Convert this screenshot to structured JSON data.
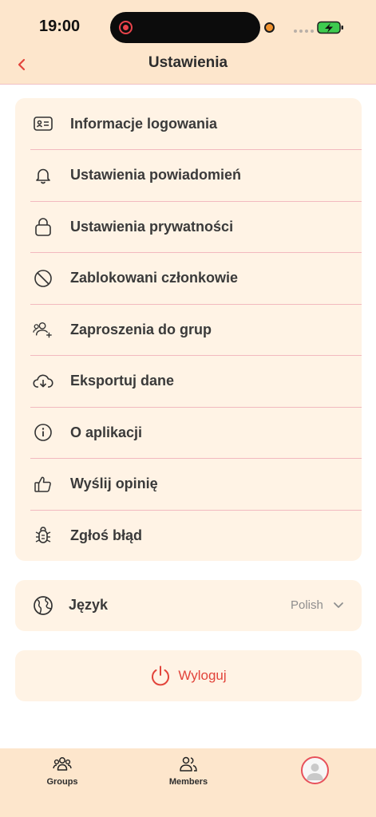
{
  "status_bar": {
    "time": "19:00"
  },
  "header": {
    "back_icon": "chevron-left-icon",
    "title": "Ustawienia"
  },
  "menu": {
    "items": [
      {
        "label": "Informacje logowania",
        "icon": "id-card-icon"
      },
      {
        "label": "Ustawienia powiadomień",
        "icon": "bell-icon"
      },
      {
        "label": "Ustawienia prywatności",
        "icon": "lock-icon"
      },
      {
        "label": "Zablokowani członkowie",
        "icon": "blocked-icon"
      },
      {
        "label": "Zaproszenia do grup",
        "icon": "user-plus-icon"
      },
      {
        "label": "Eksportuj dane",
        "icon": "cloud-download-icon"
      },
      {
        "label": "O aplikacji",
        "icon": "info-icon"
      },
      {
        "label": "Wyślij opinię",
        "icon": "thumbs-up-icon"
      },
      {
        "label": "Zgłoś błąd",
        "icon": "bug-icon"
      }
    ]
  },
  "language": {
    "label": "Język",
    "value": "Polish",
    "icon": "globe-icon"
  },
  "logout": {
    "label": "Wyloguj",
    "icon": "power-icon"
  },
  "tabbar": {
    "groups_label": "Groups",
    "members_label": "Members"
  },
  "colors": {
    "header_bg": "#fde6cc",
    "card_bg": "#fff3e5",
    "divider": "#f2b9bf",
    "accent_red": "#e2443b"
  }
}
